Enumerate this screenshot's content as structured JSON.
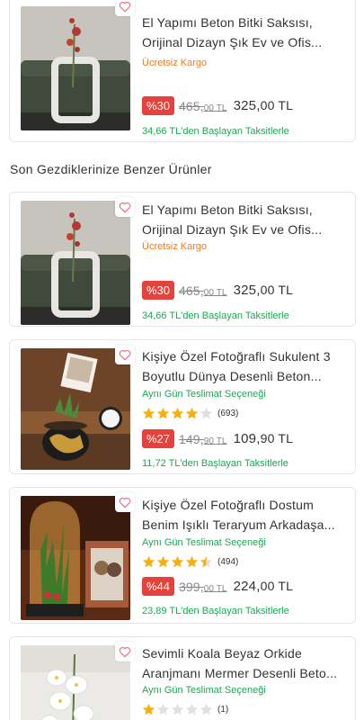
{
  "section_title": "Son Gezdiklerinize Benzer Ürünler",
  "colors": {
    "discount_bg": "#e4423a",
    "green": "#1ea754",
    "orange": "#f27a1a",
    "star": "#f6b016",
    "heart": "#f27a8b"
  },
  "products": [
    {
      "title": "El Yapımı Beton Bitki Saksısı, Orijinal Dizayn Şık Ev ve Ofis...",
      "badge": "Ücretsiz Kargo",
      "discount": "%30",
      "old_price_int": "465,",
      "old_price_dec": "00 TL",
      "new_price_int": "325,",
      "new_price_dec": "00 TL",
      "installment": "34,66 TL'den Başlayan Taksitlerle"
    },
    {
      "title": "El Yapımı Beton Bitki Saksısı, Orijinal Dizayn Şık Ev ve Ofis...",
      "badge": "Ücretsiz Kargo",
      "discount": "%30",
      "old_price_int": "465,",
      "old_price_dec": "00 TL",
      "new_price_int": "325,",
      "new_price_dec": "00 TL",
      "installment": "34,66 TL'den Başlayan Taksitlerle"
    },
    {
      "title": "Kişiye Özel Fotoğraflı Sukulent 3 Boyutlu Dünya Desenli Beton...",
      "badge": "Aynı Gün Teslimat Seçeneği",
      "rating": 4,
      "rating_count": "(693)",
      "discount": "%27",
      "old_price_int": "149,",
      "old_price_dec": "90 TL",
      "new_price_int": "109,",
      "new_price_dec": "90 TL",
      "installment": "11,72 TL'den Başlayan Taksitlerle"
    },
    {
      "title": "Kişiye Özel Fotoğraflı Dostum Benim Işıklı Teraryum Arkadaşa...",
      "badge": "Aynı Gün Teslimat Seçeneği",
      "rating": 4.5,
      "rating_count": "(494)",
      "discount": "%44",
      "old_price_int": "399,",
      "old_price_dec": "00 TL",
      "new_price_int": "224,",
      "new_price_dec": "00 TL",
      "installment": "23,89 TL'den Başlayan Taksitlerle"
    },
    {
      "title": "Sevimli Koala Beyaz Orkide Aranjmanı Mermer Desenli Beto...",
      "badge": "Aynı Gün Teslimat Seçeneği",
      "rating": 1,
      "rating_count": "(1)"
    }
  ]
}
